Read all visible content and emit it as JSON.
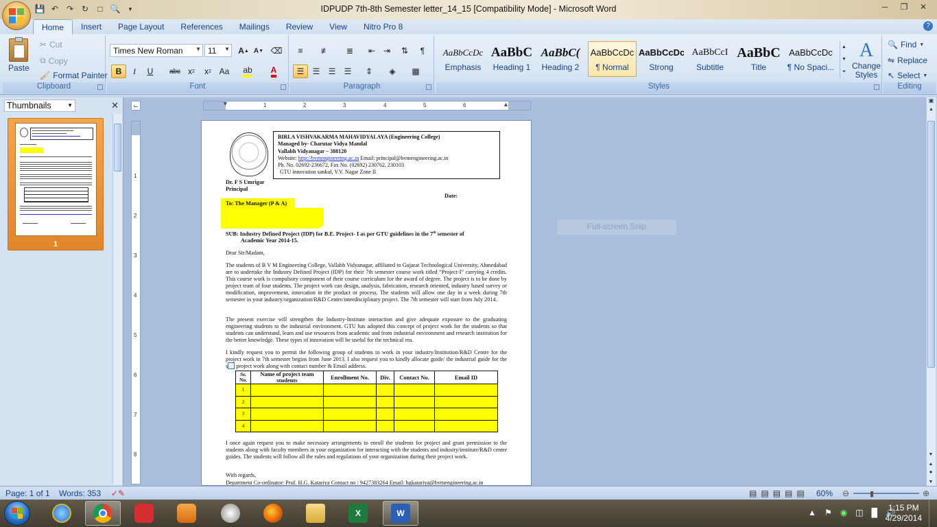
{
  "window": {
    "title": "IDPUDP 7th-8th Semester letter_14_15 [Compatibility Mode] - Microsoft Word"
  },
  "tabs": [
    "Home",
    "Insert",
    "Page Layout",
    "References",
    "Mailings",
    "Review",
    "View",
    "Nitro Pro 8"
  ],
  "active_tab": "Home",
  "ribbon": {
    "clipboard": {
      "label": "Clipboard",
      "paste": "Paste",
      "cut": "Cut",
      "copy": "Copy",
      "format_painter": "Format Painter"
    },
    "font": {
      "label": "Font",
      "family": "Times New Roman",
      "size": "11"
    },
    "paragraph": {
      "label": "Paragraph"
    },
    "styles": {
      "label": "Styles",
      "items": [
        {
          "preview": "AaBbCcDc",
          "name": "Emphasis"
        },
        {
          "preview": "AaBbC",
          "name": "Heading 1"
        },
        {
          "preview": "AaBbC(",
          "name": "Heading 2"
        },
        {
          "preview": "AaBbCcDc",
          "name": "¶ Normal"
        },
        {
          "preview": "AaBbCcDc",
          "name": "Strong"
        },
        {
          "preview": "AaBbCcI",
          "name": "Subtitle"
        },
        {
          "preview": "AaBbC",
          "name": "Title"
        },
        {
          "preview": "AaBbCcDc",
          "name": "¶ No Spaci..."
        }
      ],
      "selected": "¶ Normal",
      "change_styles": "Change Styles"
    },
    "editing": {
      "label": "Editing",
      "find": "Find",
      "replace": "Replace",
      "select": "Select"
    }
  },
  "thumbnails": {
    "title": "Thumbnails",
    "page_number": "1"
  },
  "document": {
    "letterhead": {
      "line1": "BIRLA VISHVAKARMA MAHAVIDYALAYA (Engineering College)",
      "line2": "Managed by- Charutar Vidya Mandal",
      "line3": "Vallabh Vidyanagar – 388120",
      "website_label": "Website:",
      "website": "http://bvmengineering.ac.in",
      "email": "Email: principal@bvmengineering.ac.in",
      "phone": "Ph. No. 02692-236672, Fax No. (02692) 230762, 230103",
      "gtu": "GTU innovation sankul, V.V. Nagar Zone II"
    },
    "sender_name": "Dr. F S Umrigar",
    "sender_title": "Principal",
    "date_label": "Date:",
    "to": "To: The Manager (P & A)",
    "subject_1": "SUB: Industry Defined Project (IDP) for B.E. Project- I as per GTU guidelines in the 7",
    "subject_sup": "th",
    "subject_2": " semester of",
    "subject_3": "Academic Year 2014-15.",
    "salutation": "Dear Sir/Madam,",
    "para1": "The students of B V M Engineering College, Vallabh Vidyanagar, affiliated to Gujarat Technological University, Ahmedabad are to undertake the Industry Defined Project (IDP) for their 7th semester course work titled “Project-I” carrying 4 credits. This course work is compulsory component of their course curriculum for the award of degree. The project is to be done by project team of four students. The project work can design, analysis, fabrication, research oriented, industry based survey or modification, improvement, innovation in the product or process. The students will allow one day in a week during 7th semester in your industry/organization/R&D Centre/interdisciplinary project. The 7th semester will start from July 2014.",
    "para2": "The present exercise will strengthen the Industry-Institute interaction and give adequate exposure to the graduating engineering students to the industrial environment. GTU has adopted this concept of project work for the students so that students can understand, learn and use resources from academic and from industrial environment and research institution for the better knowledge. These types of innovation will be useful for the technical era.",
    "para3": "I kindly request you to permit the following group of students to work in your industry/Institution/R&D Centre for the project work in 7th semester begins from June 2013. I also request you to kindly allocate guide/ the industrial guide for the said project work along with contact number & Email address.",
    "table": {
      "headers": [
        "Sr. No.",
        "Name of project team students",
        "Enrollment No.",
        "Div.",
        "Contact No.",
        "Email ID"
      ],
      "rows": [
        "1",
        "2",
        "3",
        "4"
      ]
    },
    "para4": "I once again request you to make necessary arrangements to enroll the students for project and grant permission to the students along with faculty members in your organization for interacting with the students and industry/institute/R&D centre guides. The students will follow all the rules and regulations of your organization during their project work.",
    "closing": "With regards,",
    "coordinator": "Department Co-ordinator: Prof. H.G. Katariya Contact no : 9427383264 Email: hgkatariya@bvmengineering.ac.in"
  },
  "overlay": {
    "snip_label": "Full-screen Snip"
  },
  "status": {
    "page": "Page: 1 of 1",
    "words": "Words: 353",
    "zoom": "60%"
  },
  "taskbar": {
    "time": "1:15 PM",
    "date": "4/29/2014"
  }
}
